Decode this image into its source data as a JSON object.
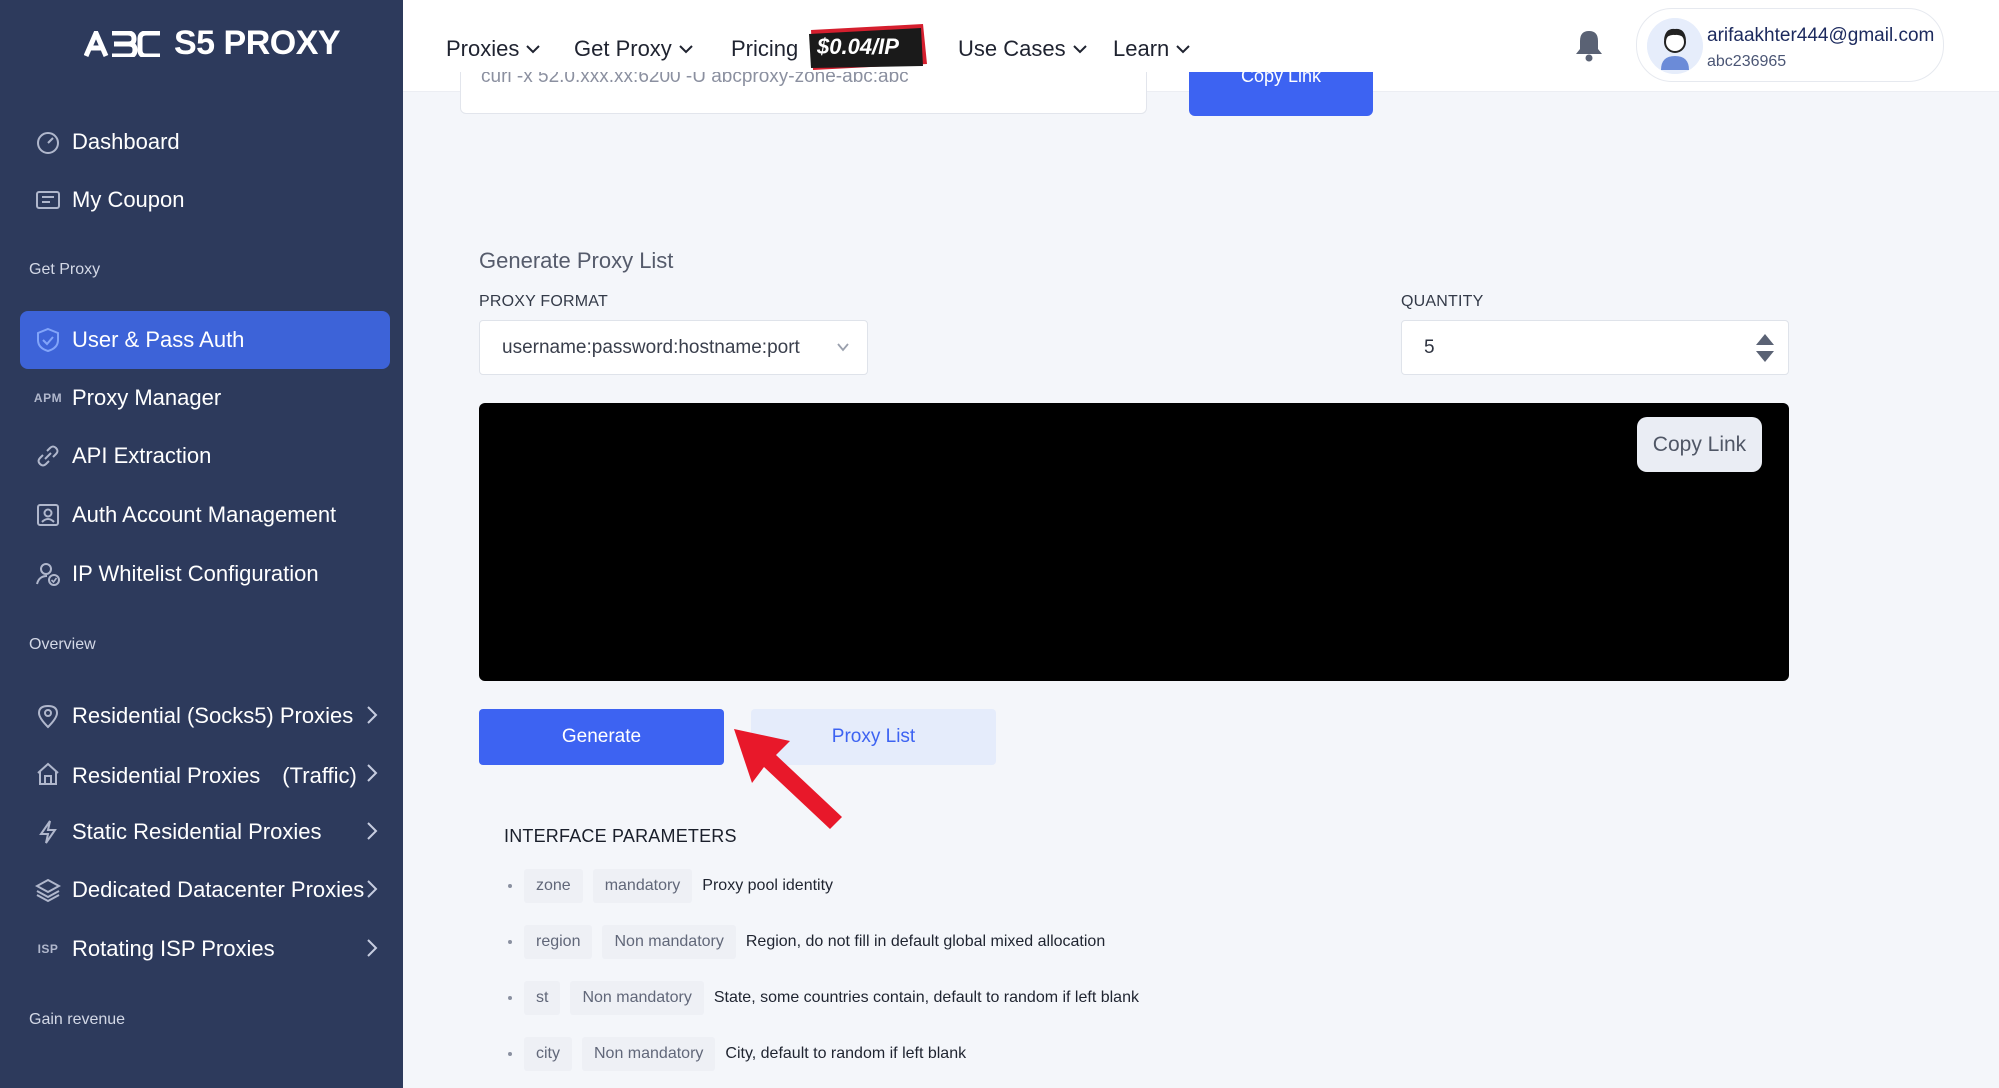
{
  "brand": {
    "logo_mark": "ABC",
    "logo_text": "S5 PROXY"
  },
  "sidebar": {
    "items_top": [
      {
        "label": "Dashboard",
        "icon": "dashboard-icon"
      },
      {
        "label": "My Coupon",
        "icon": "coupon-icon"
      }
    ],
    "section_get_proxy": "Get Proxy",
    "items_get_proxy": [
      {
        "label": "User & Pass Auth",
        "icon": "shield-icon",
        "active": true
      },
      {
        "label": "Proxy Manager",
        "icon_text": "APM"
      },
      {
        "label": "API Extraction",
        "icon": "link-icon"
      },
      {
        "label": "Auth Account Management",
        "icon": "user-card-icon"
      },
      {
        "label": "IP Whitelist Configuration",
        "icon": "user-check-icon"
      }
    ],
    "section_overview": "Overview",
    "items_overview": [
      {
        "label": "Residential (Socks5) Proxies",
        "icon": "location-pin-icon"
      },
      {
        "label": "Residential Proxies　(Traffic)",
        "icon": "house-icon"
      },
      {
        "label": "Static Residential Proxies",
        "icon": "bolt-icon"
      },
      {
        "label": "Dedicated Datacenter Proxies",
        "icon": "layers-icon"
      },
      {
        "label": "Rotating ISP Proxies",
        "icon_text": "ISP"
      }
    ],
    "section_gain_revenue": "Gain revenue"
  },
  "topnav": {
    "items": [
      "Proxies",
      "Get Proxy",
      "Pricing",
      "Use Cases",
      "Learn"
    ],
    "price_badge": "$0.04/IP"
  },
  "user": {
    "email": "arifaakhter444@gmail.com",
    "id": "abc236965"
  },
  "previous": {
    "value": "curl -x 52.0.xxx.xx:6200 -U abcproxy-zone-abc:abc",
    "copy_label": "Copy Link"
  },
  "generator": {
    "title": "Generate Proxy List",
    "format_label": "PROXY FORMAT",
    "format_value": "username:password:hostname:port",
    "quantity_label": "QUANTITY",
    "quantity_value": "5",
    "copy_label": "Copy Link",
    "generate_label": "Generate",
    "proxy_list_label": "Proxy List"
  },
  "params": {
    "title": "INTERFACE PARAMETERS",
    "rows": [
      {
        "name": "zone",
        "req": "mandatory",
        "desc": "Proxy pool identity"
      },
      {
        "name": "region",
        "req": "Non mandatory",
        "desc": "Region, do not fill in default global mixed allocation"
      },
      {
        "name": "st",
        "req": "Non mandatory",
        "desc": "State, some countries contain, default to random if left blank"
      },
      {
        "name": "city",
        "req": "Non mandatory",
        "desc": "City, default to random if left blank"
      }
    ]
  },
  "colors": {
    "sidebar_bg": "#2d3a5c",
    "accent": "#3d63f2",
    "active_item": "#3d63d8",
    "arrow": "#e8182a"
  }
}
